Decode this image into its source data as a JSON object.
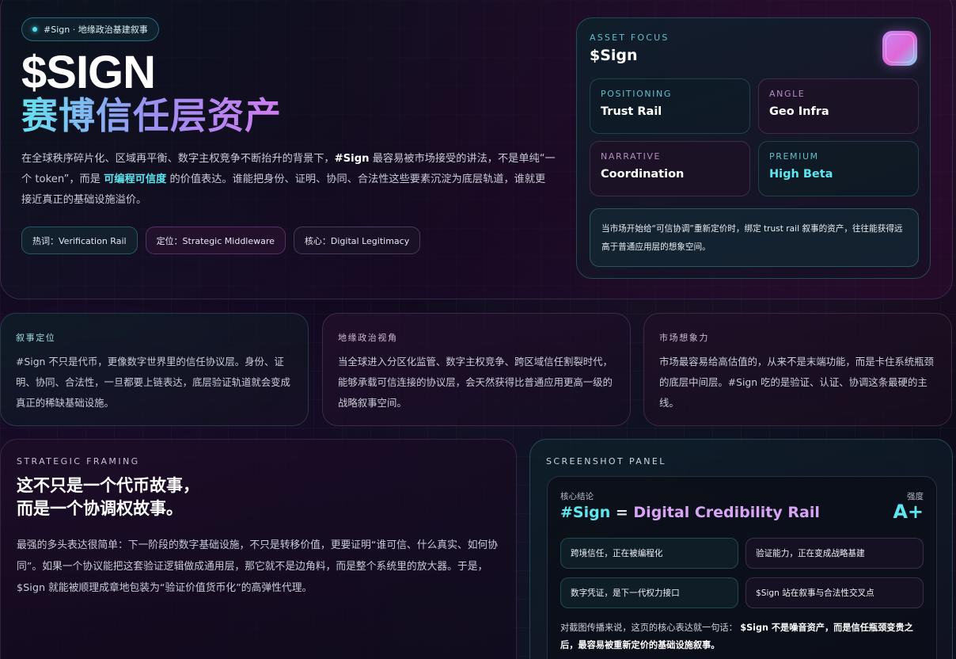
{
  "hero": {
    "tag": "#Sign · 地缘政治基建叙事",
    "title": "$SIGN",
    "subtitle": "赛博信任层资产",
    "desc": {
      "p1": "在全球秩序碎片化、区域再平衡、数字主权竞争不断抬升的背景下，",
      "bold": "#Sign",
      "p2": " 最容易被市场接受的讲法，不是单纯“一个 token”，而是 ",
      "highlight": "可编程可信度",
      "p3": " 的价值表达。谁能把身份、证明、协同、合法性这些要素沉淀为底层轨道，谁就更接近真正的基础设施溢价。"
    },
    "chips": [
      "热词：Verification Rail",
      "定位：Strategic Middleware",
      "核心：Digital Legitimacy"
    ]
  },
  "asset": {
    "eyebrow": "ASSET FOCUS",
    "name": "$Sign",
    "stats": [
      {
        "k": "POSITIONING",
        "v": "Trust Rail"
      },
      {
        "k": "ANGLE",
        "v": "Geo Infra"
      },
      {
        "k": "NARRATIVE",
        "v": "Coordination"
      },
      {
        "k": "PREMIUM",
        "v": "High Beta"
      }
    ],
    "note": "当市场开始给“可信协调”重新定价时，绑定 trust rail 叙事的资产，往往能获得远高于普通应用层的想象空间。"
  },
  "cards": [
    {
      "title": "叙事定位",
      "desc": "#Sign 不只是代币，更像数字世界里的信任协议层。身份、证明、协同、合法性，一旦都要上链表达，底层验证轨道就会变成真正的稀缺基础设施。"
    },
    {
      "title": "地缘政治视角",
      "desc": "当全球进入分区化监管、数字主权竞争、跨区域信任割裂时代，能够承载可信连接的协议层，会天然获得比普通应用更高一级的战略叙事空间。"
    },
    {
      "title": "市场想象力",
      "desc": "市场最容易给高估值的，从来不是末端功能，而是卡住系统瓶颈的底层中间层。#Sign 吃的是验证、认证、协调这条最硬的主线。"
    }
  ],
  "strategic": {
    "eyebrow": "STRATEGIC FRAMING",
    "headline1": "这不只是一个代币故事，",
    "headline2": "而是一个协调权故事。",
    "desc": "最强的多头表达很简单：下一阶段的数字基础设施，不只是转移价值，更要证明“谁可信、什么真实、如何协同”。如果一个协议能把这套验证逻辑做成通用层，那它就不是边角料，而是整个系统里的放大器。于是，$Sign 就能被顺理成章地包装为“验证价值货币化”的高弹性代理。"
  },
  "screenshot": {
    "eyebrow": "SCREENSHOT PANEL",
    "label_left": "核心结论",
    "label_right": "强度",
    "headline_a": "#Sign",
    "headline_b": " = ",
    "headline_c": "Digital Credibility Rail",
    "grade": "A+",
    "facts": [
      "跨境信任，正在被编程化",
      "验证能力，正在变成战略基建",
      "数字凭证，是下一代权力接口",
      "$Sign 站在叙事与合法性交叉点"
    ],
    "summary_p1": "对截图传播来说，这页的核心表达就一句话：",
    "summary_bold": "$Sign 不是噪音资产，而是信任瓶颈变贵之后，最容易被重新定价的基础设施叙事。"
  }
}
